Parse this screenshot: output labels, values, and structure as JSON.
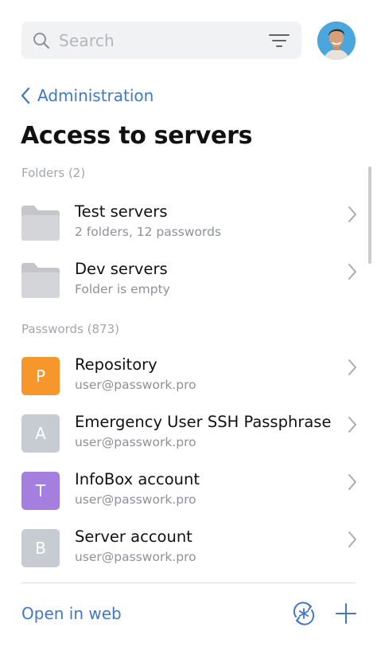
{
  "search": {
    "placeholder": "Search",
    "icon": "search-icon",
    "filter_icon": "filter-icon"
  },
  "avatar": {
    "icon": "avatar"
  },
  "breadcrumb": {
    "back_label": "Administration"
  },
  "page": {
    "title": "Access to servers"
  },
  "folders": {
    "label": "Folders (2)",
    "items": [
      {
        "title": "Test servers",
        "subtitle": "2 folders, 12 passwords"
      },
      {
        "title": "Dev servers",
        "subtitle": "Folder is empty"
      }
    ]
  },
  "passwords": {
    "label": "Passwords (873)",
    "items": [
      {
        "letter": "P",
        "title": "Repository",
        "subtitle": "user@passwork.pro",
        "color": "#f7972b"
      },
      {
        "letter": "A",
        "title": "Emergency User SSH Passphrase",
        "subtitle": "user@passwork.pro",
        "color": "#c7ccd2"
      },
      {
        "letter": "T",
        "title": "InfoBox account",
        "subtitle": "user@passwork.pro",
        "color": "#a57fe0"
      },
      {
        "letter": "B",
        "title": "Server account",
        "subtitle": "user@passwork.pro",
        "color": "#c7ccd2"
      }
    ]
  },
  "footer": {
    "open_web_label": "Open in web",
    "generator_icon": "password-generator-icon",
    "add_icon": "plus-icon"
  },
  "colors": {
    "accent": "#3f79c5",
    "muted": "#a2a7ad",
    "folder": "#c7c9cc"
  }
}
